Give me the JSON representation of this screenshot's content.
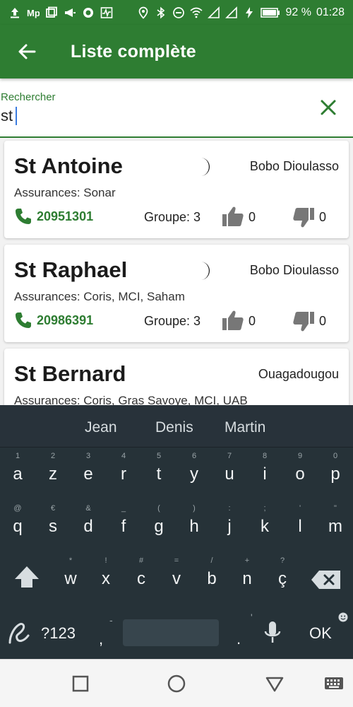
{
  "status_bar": {
    "left_icons": [
      "upload-icon",
      "mp-icon",
      "window-icon",
      "megaphone-icon",
      "record-icon",
      "activity-icon"
    ],
    "right_icons": [
      "location-icon",
      "bluetooth-icon",
      "dnd-icon",
      "wifi-icon",
      "signal-icon",
      "signal-icon",
      "charging-icon",
      "battery-icon"
    ],
    "battery": "92 %",
    "time": "01:28"
  },
  "app_bar": {
    "title": "Liste complète",
    "back_icon": "arrow-left-icon"
  },
  "search": {
    "label": "Rechercher",
    "value": "st",
    "clear_icon": "close-icon"
  },
  "results": [
    {
      "name": "St Antoine",
      "city": "Bobo Dioulasso",
      "insurances": "Assurances: Sonar",
      "phone": "20951301",
      "group": "Groupe: 3",
      "likes": "0",
      "dislikes": "0",
      "night_icon": "moon-icon"
    },
    {
      "name": "St Raphael",
      "city": "Bobo Dioulasso",
      "insurances": "Assurances: Coris, MCI, Saham",
      "phone": "20986391",
      "group": "Groupe: 3",
      "likes": "0",
      "dislikes": "0",
      "night_icon": "moon-icon"
    },
    {
      "name": "St Bernard",
      "city": "Ouagadougou",
      "insurances": "Assurances: Coris, Gras Savoye, MCI, UAB"
    }
  ],
  "keyboard": {
    "suggestions": [
      "Jean",
      "Denis",
      "Martin"
    ],
    "row1": [
      {
        "hint": "1",
        "key": "a"
      },
      {
        "hint": "2",
        "key": "z"
      },
      {
        "hint": "3",
        "key": "e"
      },
      {
        "hint": "4",
        "key": "r"
      },
      {
        "hint": "5",
        "key": "t"
      },
      {
        "hint": "6",
        "key": "y"
      },
      {
        "hint": "7",
        "key": "u"
      },
      {
        "hint": "8",
        "key": "i"
      },
      {
        "hint": "9",
        "key": "o"
      },
      {
        "hint": "0",
        "key": "p"
      }
    ],
    "row2": [
      {
        "hint": "@",
        "key": "q"
      },
      {
        "hint": "€",
        "key": "s"
      },
      {
        "hint": "&",
        "key": "d"
      },
      {
        "hint": "_",
        "key": "f"
      },
      {
        "hint": "(",
        "key": "g"
      },
      {
        "hint": ")",
        "key": "h"
      },
      {
        "hint": ":",
        "key": "j"
      },
      {
        "hint": ";",
        "key": "k"
      },
      {
        "hint": "'",
        "key": "l"
      },
      {
        "hint": "\"",
        "key": "m"
      }
    ],
    "row3": [
      {
        "hint": "*",
        "key": "w"
      },
      {
        "hint": "!",
        "key": "x"
      },
      {
        "hint": "#",
        "key": "c"
      },
      {
        "hint": "=",
        "key": "v"
      },
      {
        "hint": "/",
        "key": "b"
      },
      {
        "hint": "+",
        "key": "n"
      },
      {
        "hint": "?",
        "key": "ç"
      }
    ],
    "symbols_label": "?123",
    "comma": ",",
    "comma_hint": "-",
    "period": ".",
    "period_hint": "'",
    "ok_label": "OK"
  },
  "nav_bar": {
    "icons": [
      "recents-square-icon",
      "home-circle-icon",
      "back-triangle-icon",
      "keyboard-switch-icon"
    ]
  },
  "colors": {
    "primary": "#2e7d32",
    "keyboard_bg": "#263238"
  }
}
